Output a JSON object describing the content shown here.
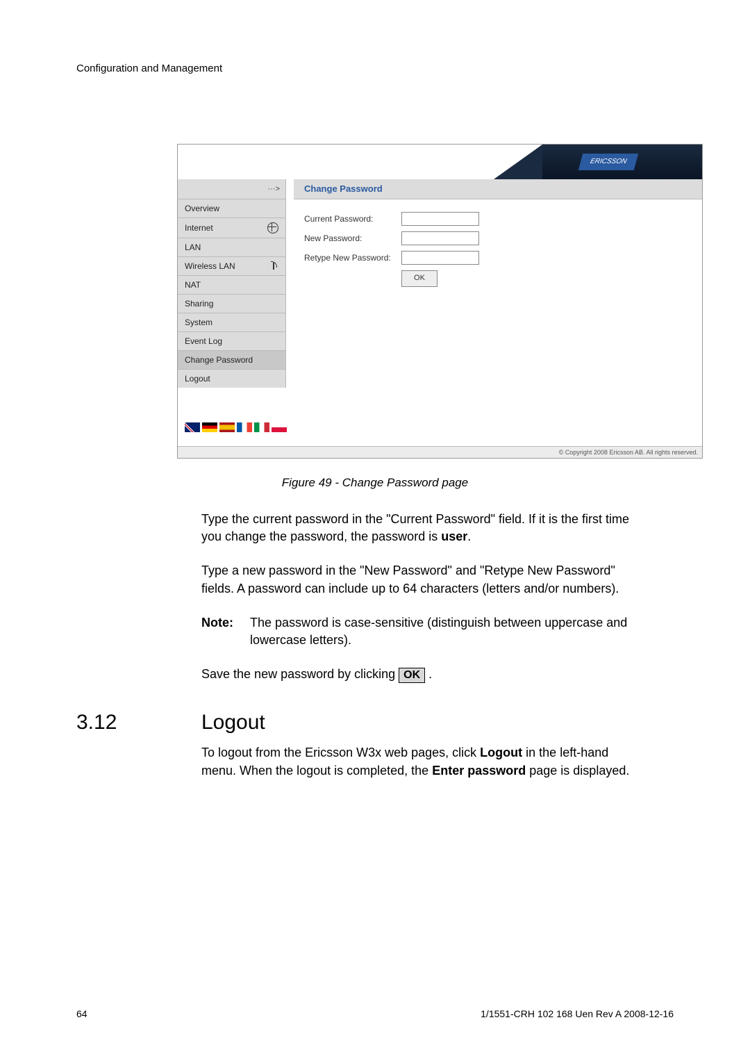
{
  "header": "Configuration and Management",
  "screenshot": {
    "brand": "ERICSSON",
    "breadcrumb_arrow": "···>",
    "breadcrumb": "Change Password",
    "nav": {
      "overview": "Overview",
      "internet": "Internet",
      "lan": "LAN",
      "wlan": "Wireless LAN",
      "nat": "NAT",
      "sharing": "Sharing",
      "system": "System",
      "eventlog": "Event Log",
      "changepw": "Change Password",
      "logout": "Logout"
    },
    "form": {
      "current": "Current Password:",
      "newp": "New Password:",
      "retype": "Retype New Password:",
      "ok": "OK"
    },
    "footer": "© Copyright 2008 Ericsson AB. All rights reserved."
  },
  "caption": "Figure 49 - Change Password page",
  "para1_a": "Type the current password in the \"Current Password\" field. If it is the first time you change the password, the password is ",
  "para1_b": "user",
  "para1_c": ".",
  "para2": "Type a new password in the \"New Password\" and \"Retype New Password\" fields. A password can include up to 64 characters (letters and/or numbers).",
  "note_label": "Note:",
  "note_text": "The password is case-sensitive (distinguish between uppercase and lowercase letters).",
  "save_a": "Save the new password by clicking ",
  "save_b": "OK",
  "save_c": " .",
  "section": {
    "num": "3.12",
    "title": "Logout"
  },
  "logout_a": "To logout from the Ericsson W3x web pages, click ",
  "logout_b": "Logout",
  "logout_c": " in the left-hand menu. When the logout is completed, the ",
  "logout_d": "Enter password",
  "logout_e": " page is displayed.",
  "footer": {
    "page": "64",
    "doc": "1/1551-CRH 102 168 Uen Rev A  2008-12-16"
  }
}
